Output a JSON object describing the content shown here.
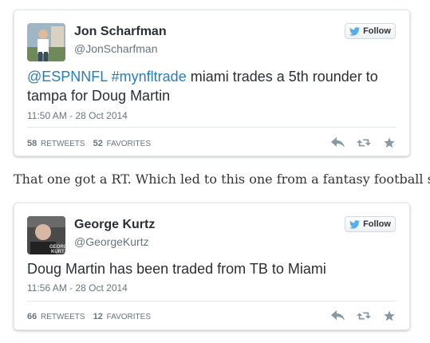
{
  "tweets": [
    {
      "author_name": "Jon Scharfman",
      "handle": "@JonScharfman",
      "follow_label": "Follow",
      "text_parts": [
        "@ESPNNFL",
        " ",
        "#mynfltrade",
        " miami trades a 5th rounder to tampa for Doug Martin"
      ],
      "timestamp": "11:50 AM - 28 Oct 2014",
      "retweets_count": "58",
      "retweets_label": "RETWEETS",
      "favorites_count": "52",
      "favorites_label": "FAVORITES"
    },
    {
      "author_name": "George Kurtz",
      "handle": "@GeorgeKurtz",
      "follow_label": "Follow",
      "text": "Doug Martin has been traded from TB to Miami",
      "timestamp": "11:56 AM - 28 Oct 2014",
      "retweets_count": "66",
      "retweets_label": "RETWEETS",
      "favorites_count": "12",
      "favorites_label": "FAVORITES"
    }
  ],
  "between_text": "That one got a RT. Which led to this one from a fantasy football sho",
  "icons": {
    "follow": "twitter-bird-icon",
    "reply": "reply-icon",
    "retweet": "retweet-icon",
    "favorite": "star-icon"
  },
  "colors": {
    "link": "#2b7bb9",
    "muted": "#66757f",
    "text": "#292f33",
    "bird": "#55acee",
    "action": "#8899a6"
  }
}
